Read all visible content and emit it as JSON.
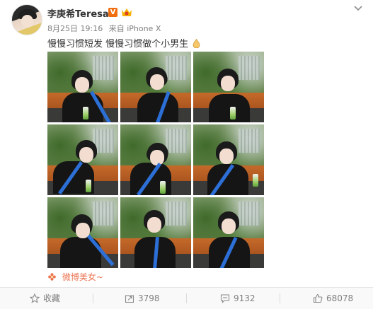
{
  "post": {
    "user_name": "李庚希Teresa",
    "verified_badge": "V",
    "date": "8月25日 19:16",
    "source": "来自 iPhone X",
    "text": "慢慢习惯短发 慢慢习惯做个小男生"
  },
  "sticker": {
    "label": "微博美女~"
  },
  "actions": {
    "favorite_label": "收藏",
    "repost_count": "3798",
    "comment_count": "9132",
    "like_count": "68078"
  },
  "colors": {
    "accent": "#eb7350",
    "verified": "#f06e0f",
    "strap_blue": "#2c6fd6"
  },
  "icons": {
    "more": "chevron-down-icon",
    "favorite": "star-icon",
    "repost": "repost-icon",
    "comment": "comment-icon",
    "like": "thumbs-up-icon"
  },
  "photos": [
    {
      "pose": "hands-on-cheek"
    },
    {
      "pose": "hands-on-cheek-tilt"
    },
    {
      "pose": "hands-under-chin"
    },
    {
      "pose": "standing"
    },
    {
      "pose": "head-tilt"
    },
    {
      "pose": "peace-sign"
    },
    {
      "pose": "looking-down"
    },
    {
      "pose": "standing-front"
    },
    {
      "pose": "standing-front-2"
    }
  ]
}
